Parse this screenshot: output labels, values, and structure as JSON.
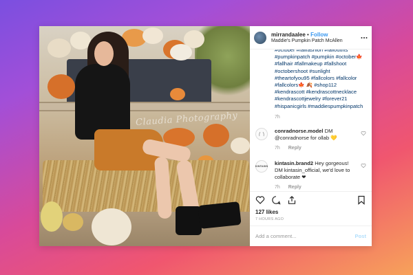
{
  "post": {
    "username": "mirrandaalee",
    "separator": "•",
    "follow_label": "Follow",
    "location": "Maddie's Pumpkin Patch McAllen",
    "more_icon": "more-icon",
    "watermark": "Claudia Photography",
    "caption_tags": "#october #fallfashion #falloutfits #pumpkinpatch #pumpkin #october🍁 #fallhair #fallmakeup #fallshoot #octobershoot #sunlight #theartofyou95 #fallcolors #fallcolor #fallcolors🍁 🍂 #shop112 #kendrascott #kendrascottnecklace #kendrascottjewelry #forever21 #hispanicgirls #maddiespumpkinpatch",
    "caption_time": "7h"
  },
  "comments": [
    {
      "user": "conradnorse.model",
      "text": "DM @conradnorse for ollab 💛",
      "time": "7h",
      "reply": "Reply",
      "avatar_text": ""
    },
    {
      "user": "kintasin.brand2",
      "text": "Hey gorgeous! DM kintasin_official, we'd love to collaborate ❤",
      "time": "7h",
      "reply": "Reply",
      "avatar_text": "KINTASIN"
    }
  ],
  "actions": {
    "likes": "127 likes",
    "ago": "7 HOURS AGO",
    "comment_placeholder": "Add a comment...",
    "post_label": "Post"
  },
  "colors": {
    "link": "#003569",
    "follow": "#3897f0",
    "muted": "#999999"
  }
}
